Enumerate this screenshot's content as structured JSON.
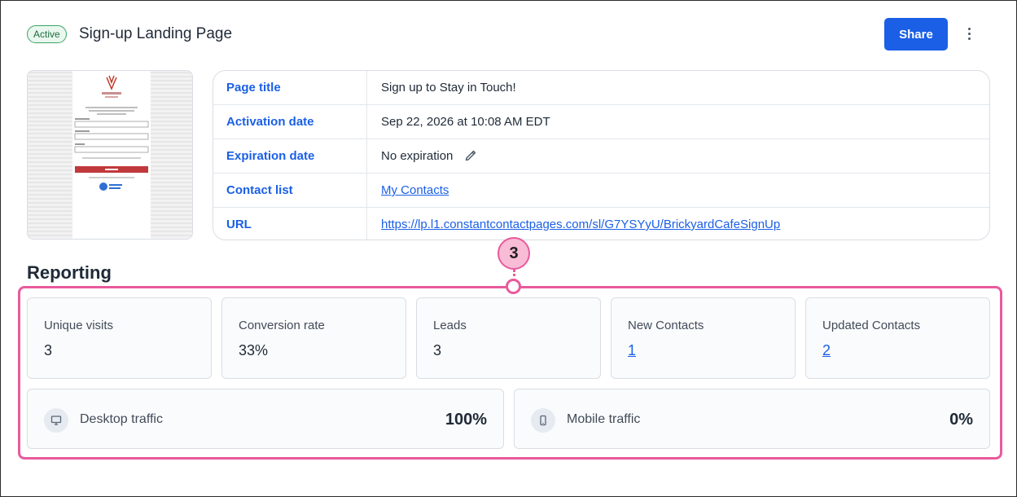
{
  "header": {
    "status_badge": "Active",
    "title": "Sign-up Landing Page",
    "share_label": "Share"
  },
  "details": {
    "rows": [
      {
        "label": "Page title",
        "value": "Sign up to Stay in Touch!"
      },
      {
        "label": "Activation date",
        "value": "Sep 22, 2026 at 10:08 AM EDT"
      },
      {
        "label": "Expiration date",
        "value": "No expiration"
      },
      {
        "label": "Contact list",
        "value": "My Contacts"
      },
      {
        "label": "URL",
        "value": "https://lp.l1.constantcontactpages.com/sl/G7YSYyU/BrickyardCafeSignUp"
      }
    ]
  },
  "reporting": {
    "title": "Reporting",
    "callout_number": "3",
    "stats": [
      {
        "label": "Unique visits",
        "value": "3"
      },
      {
        "label": "Conversion rate",
        "value": "33%"
      },
      {
        "label": "Leads",
        "value": "3"
      },
      {
        "label": "New Contacts",
        "value": "1"
      },
      {
        "label": "Updated Contacts",
        "value": "2"
      }
    ],
    "traffic": [
      {
        "label": "Desktop traffic",
        "value": "100%",
        "icon": "desktop-icon"
      },
      {
        "label": "Mobile traffic",
        "value": "0%",
        "icon": "mobile-icon"
      }
    ]
  },
  "colors": {
    "brand_blue": "#1a5fe6",
    "highlight_pink": "#e85a9c",
    "active_green": "#3aa464"
  }
}
